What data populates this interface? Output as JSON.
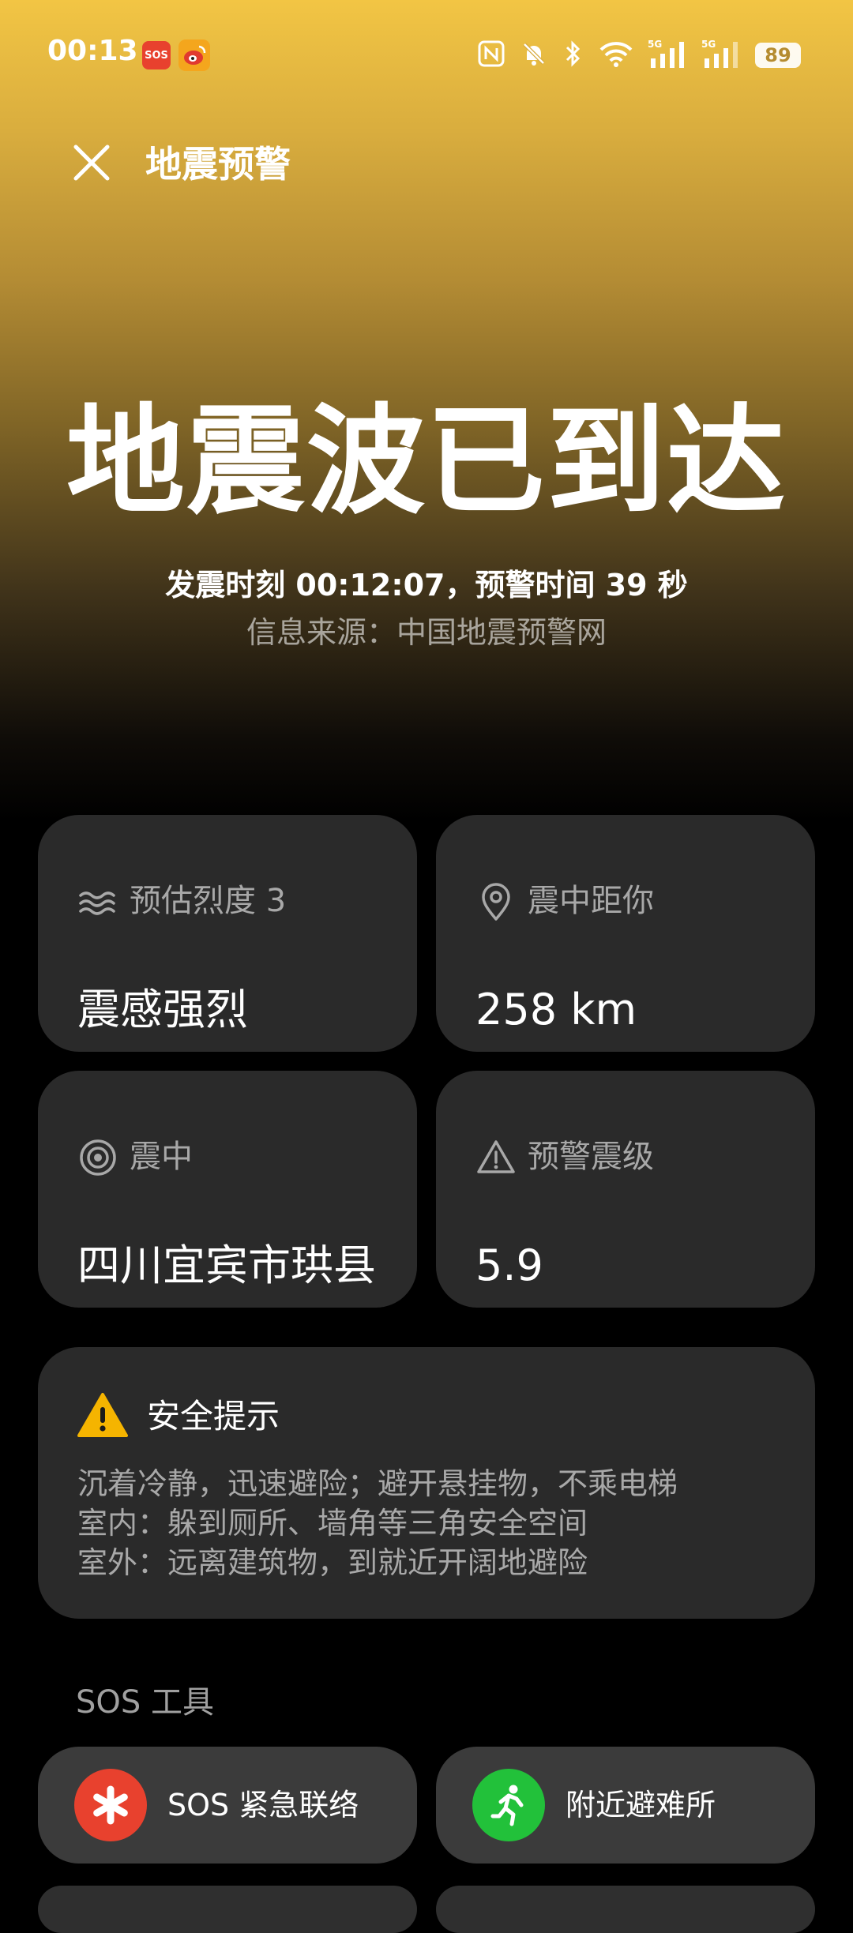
{
  "status_bar": {
    "time": "00:13",
    "sos_badge": "SOS",
    "battery": "89",
    "icons": [
      "nfc-icon",
      "bell-muted-icon",
      "bluetooth-icon",
      "wifi-icon",
      "signal-5g-icon",
      "signal-5g-icon"
    ]
  },
  "header": {
    "title": "地震预警",
    "close_icon": "close-icon"
  },
  "hero": {
    "headline": "地震波已到达",
    "detail": "发震时刻 00:12:07，预警时间 39 秒",
    "source": "信息来源：中国地震预警网"
  },
  "cards": {
    "intensity": {
      "label": "预估烈度 3",
      "value": "震感强烈",
      "icon": "wave-icon"
    },
    "distance": {
      "label": "震中距你",
      "value": "258 km",
      "icon": "location-pin-icon"
    },
    "epicenter": {
      "label": "震中",
      "value": "四川宜宾市珙县",
      "icon": "target-icon"
    },
    "magnitude": {
      "label": "预警震级",
      "value": "5.9",
      "icon": "warning-icon"
    }
  },
  "safety": {
    "title": "安全提示",
    "lines": [
      "沉着冷静，迅速避险；避开悬挂物，不乘电梯",
      "室内：躲到厕所、墙角等三角安全空间",
      "室外：远离建筑物，到就近开阔地避险"
    ]
  },
  "sos_tools": {
    "title": "SOS 工具",
    "emergency_contact": "SOS 紧急联络",
    "nearby_shelter": "附近避难所"
  },
  "colors": {
    "hero_top": "#f2c544",
    "card_bg": "#2a2a2a",
    "tool_bg": "#3b3b3b",
    "sos_red": "#e8412e",
    "shelter_green": "#22c13a",
    "warning_amber": "#f5b400"
  }
}
